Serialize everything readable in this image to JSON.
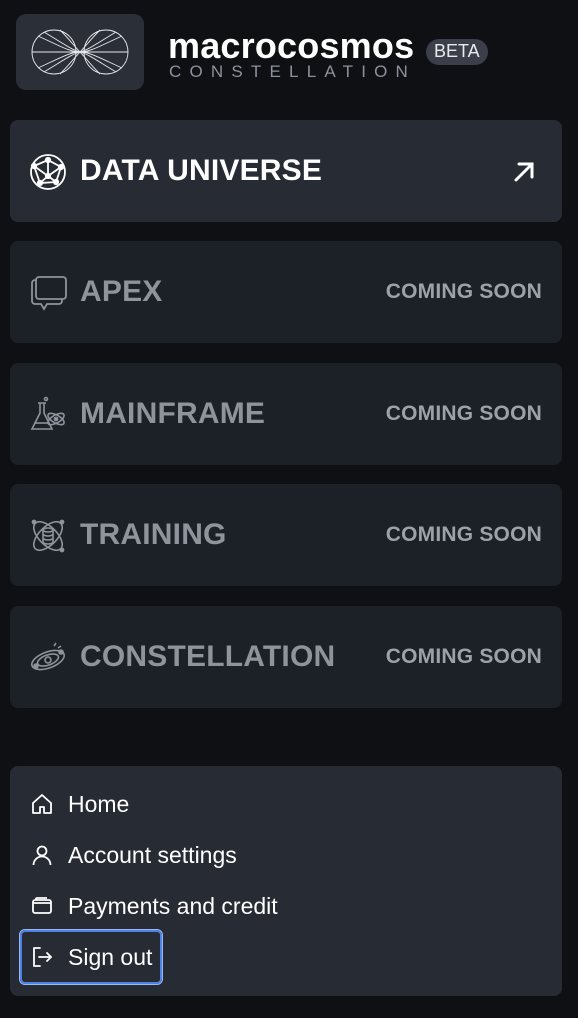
{
  "brand": {
    "name": "macrocosmos",
    "badge": "BETA",
    "subtitle": "CONSTELLATION"
  },
  "products": [
    {
      "title": "DATA UNIVERSE",
      "status": "",
      "icon": "globe-network-icon",
      "active": true
    },
    {
      "title": "APEX",
      "status": "COMING SOON",
      "icon": "chat-bubbles-icon",
      "active": false
    },
    {
      "title": "MAINFRAME",
      "status": "COMING SOON",
      "icon": "flask-atom-icon",
      "active": false
    },
    {
      "title": "TRAINING",
      "status": "COMING SOON",
      "icon": "database-orbit-icon",
      "active": false
    },
    {
      "title": "CONSTELLATION",
      "status": "COMING SOON",
      "icon": "planet-orbit-icon",
      "active": false
    }
  ],
  "menu": {
    "items": [
      {
        "label": "Home",
        "icon": "home-icon"
      },
      {
        "label": "Account settings",
        "icon": "user-icon"
      },
      {
        "label": "Payments and credit",
        "icon": "wallet-icon"
      },
      {
        "label": "Sign out",
        "icon": "sign-out-icon"
      }
    ]
  },
  "colors": {
    "background": "#0e1014",
    "card": "#1c2027",
    "card_active": "#272b33",
    "focus_ring": "#4b83e8"
  }
}
